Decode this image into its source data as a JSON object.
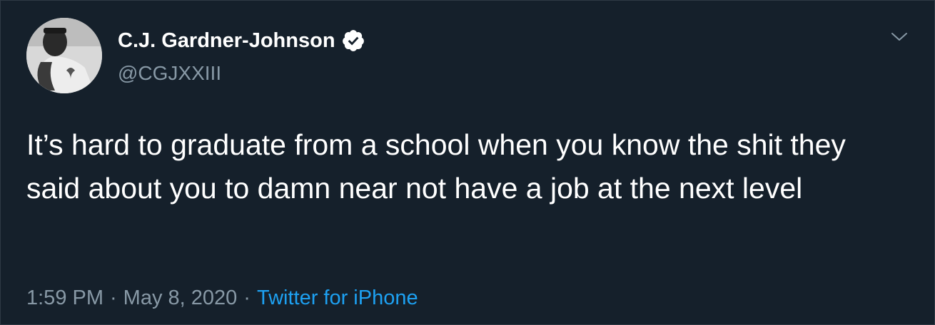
{
  "author": {
    "display_name": "C.J. Gardner-Johnson",
    "handle": "@CGJXXIII",
    "verified": true
  },
  "tweet": {
    "text": "It’s hard to graduate from a school when you know the shit they said about you to damn near not have a job at the next level"
  },
  "meta": {
    "time": "1:59 PM",
    "separator": "·",
    "date": "May 8, 2020",
    "source": "Twitter for iPhone"
  },
  "colors": {
    "background": "#15202b",
    "primary_text": "#ffffff",
    "secondary_text": "#8899a6",
    "accent": "#1da1f2"
  },
  "icons": {
    "verified": "verified-badge-icon",
    "menu": "chevron-down-icon"
  }
}
